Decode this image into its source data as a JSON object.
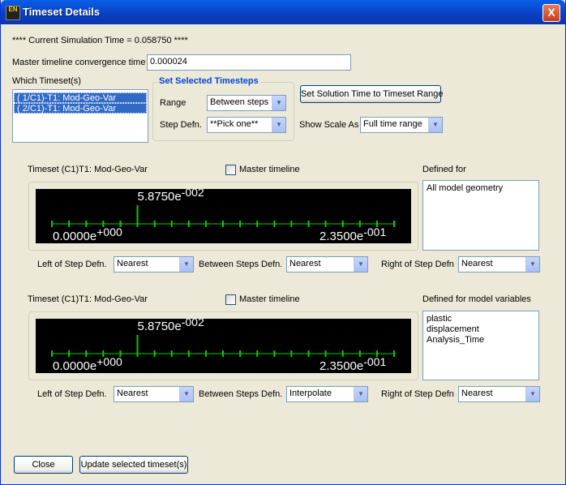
{
  "window": {
    "title": "Timeset Details",
    "icon_text": "EN",
    "close_label": "X"
  },
  "sim_time_text": "**** Current Simulation Time = 0.058750 ****",
  "master_convergence": {
    "label": "Master timeline convergence time",
    "value": "0.000024"
  },
  "which_timesets": {
    "label": "Which Timeset(s)",
    "items": [
      "( 1/C1)-T1: Mod-Geo-Var",
      "( 2/C1)-T1: Mod-Geo-Var"
    ]
  },
  "set_timesteps": {
    "title": "Set Selected Timesteps",
    "range_label": "Range",
    "range_value": "Between steps",
    "stepdefn_label": "Step Defn.",
    "stepdefn_value": "**Pick one**"
  },
  "set_solution_button": "Set Solution Time to Timeset Range",
  "show_scale": {
    "label": "Show Scale As",
    "value": "Full time range"
  },
  "panels": [
    {
      "title": "Timeset (C1)T1: Mod-Geo-Var",
      "master_label": "Master timeline",
      "defined_label": "Defined for",
      "defined_items": [
        "All model geometry"
      ],
      "marker_mantissa": "5.8750e",
      "marker_exp": "-002",
      "min_mantissa": "0.0000e",
      "min_exp": "+000",
      "max_mantissa": "2.3500e",
      "max_exp": "-001",
      "left_label": "Left of Step Defn.",
      "left_value": "Nearest",
      "between_label": "Between Steps Defn.",
      "between_value": "Nearest",
      "right_label": "Right of Step Defn",
      "right_value": "Nearest"
    },
    {
      "title": "Timeset (C1)T1: Mod-Geo-Var",
      "master_label": "Master timeline",
      "defined_label": "Defined for model variables",
      "defined_items": [
        "plastic",
        "displacement",
        "Analysis_Time"
      ],
      "marker_mantissa": "5.8750e",
      "marker_exp": "-002",
      "min_mantissa": "0.0000e",
      "min_exp": "+000",
      "max_mantissa": "2.3500e",
      "max_exp": "-001",
      "left_label": "Left of Step Defn.",
      "left_value": "Nearest",
      "between_label": "Between Steps Defn.",
      "between_value": "Interpolate",
      "right_label": "Right of Step Defn",
      "right_value": "Nearest"
    }
  ],
  "timeline": {
    "min": 0.0,
    "max": 0.235,
    "current": 0.05875,
    "tick_count": 20,
    "tick_color": "#00d000",
    "text_color": "#ffffff"
  },
  "footer": {
    "close_label": "Close",
    "update_label": "Update selected timeset(s)"
  }
}
